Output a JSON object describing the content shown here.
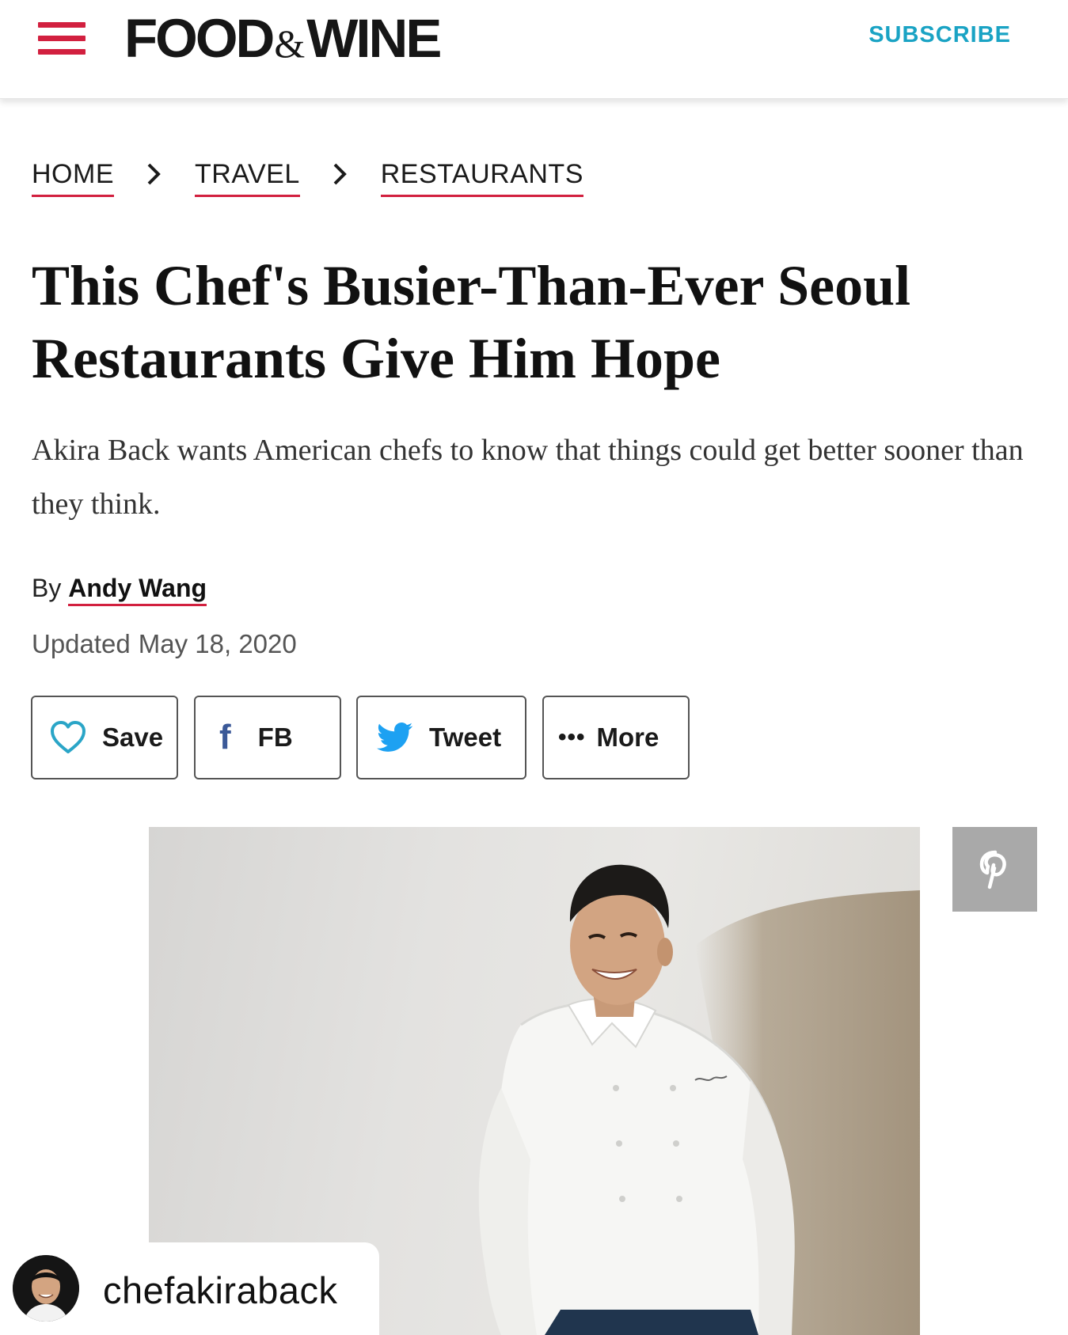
{
  "header": {
    "logo_left": "FOOD",
    "logo_amp": "&",
    "logo_right": "WINE",
    "subscribe_label": "SUBSCRIBE"
  },
  "breadcrumb": [
    {
      "label": "HOME"
    },
    {
      "label": "TRAVEL"
    },
    {
      "label": "RESTAURANTS"
    }
  ],
  "article": {
    "title": "This Chef's Busier-Than-Ever Seoul Restaurants Give Him Hope",
    "dek": "Akira Back wants American chefs to know that things could get better sooner than they think.",
    "byline_prefix": "By",
    "author": "Andy Wang",
    "updated_label": "Updated",
    "updated_date": "May 18, 2020"
  },
  "share": {
    "save_label": "Save",
    "fb_label": "FB",
    "tweet_label": "Tweet",
    "more_label": "More",
    "more_dots": "•••"
  },
  "image": {
    "subject": "chef-portrait",
    "pin_icon": "pinterest-icon"
  },
  "instagram": {
    "handle": "chefakiraback"
  },
  "colors": {
    "accent_red": "#d2203f",
    "subscribe_blue": "#1aa3c4",
    "facebook_blue": "#3b5998",
    "twitter_blue": "#1da1f2",
    "save_heart": "#2aa5c7"
  }
}
